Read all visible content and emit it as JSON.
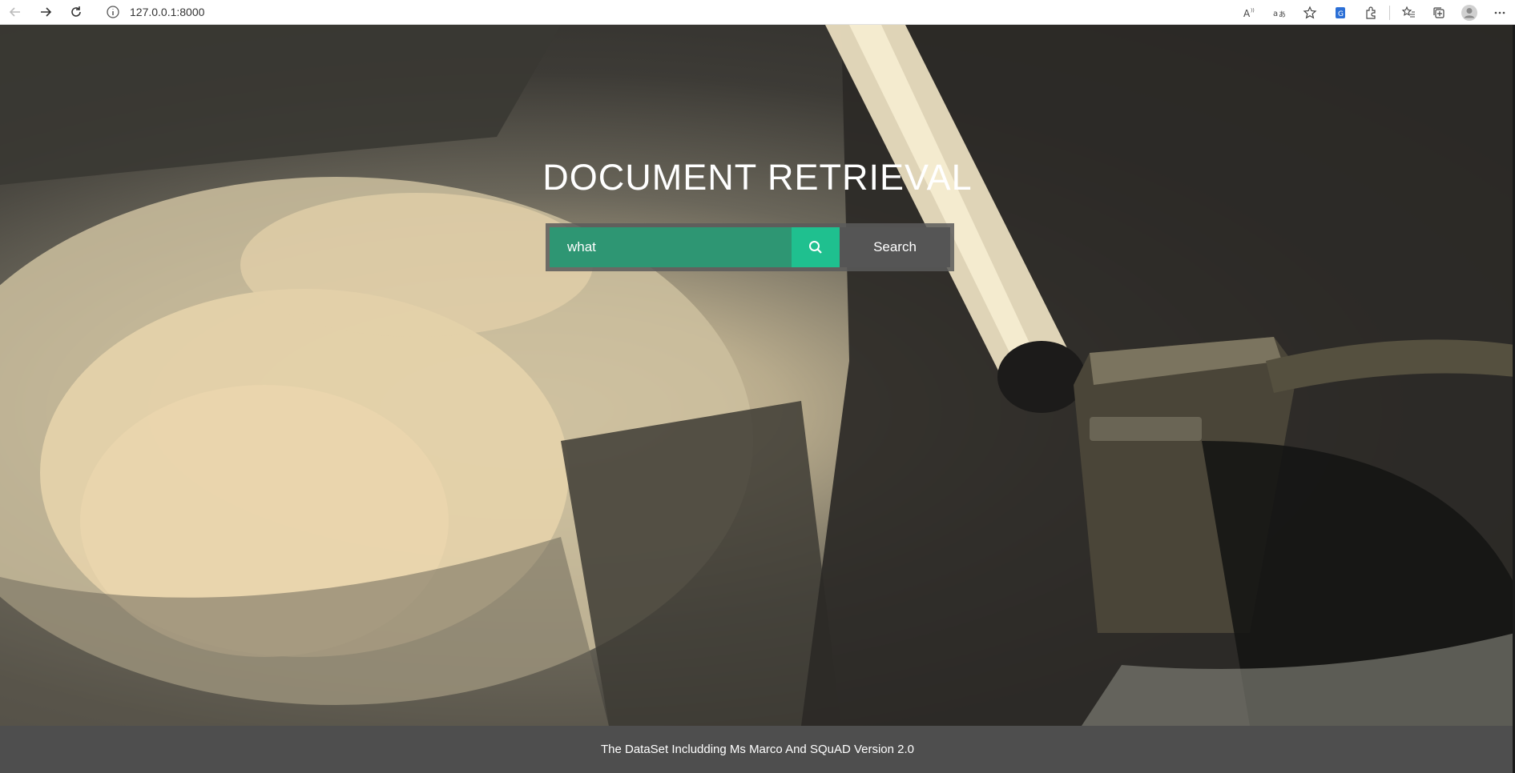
{
  "browser": {
    "url": "127.0.0.1:8000"
  },
  "hero": {
    "title": "DOCUMENT RETRIEVAL"
  },
  "search": {
    "value": "what ",
    "button_label": "Search"
  },
  "footer": {
    "text": "The DataSet Includding Ms Marco And SQuAD Version 2.0"
  },
  "colors": {
    "input_bg": "#2e9673",
    "icon_button_bg": "#1fc08f",
    "search_button_bg": "#555555",
    "footer_bg": "#4e4e4e"
  },
  "icons": [
    "back-icon",
    "forward-icon",
    "refresh-icon",
    "info-icon",
    "read-aloud-icon",
    "translate-icon",
    "favorite-icon",
    "extension-badge-icon",
    "extensions-icon",
    "favorites-icon",
    "collections-icon",
    "profile-icon",
    "more-icon",
    "search-icon"
  ]
}
